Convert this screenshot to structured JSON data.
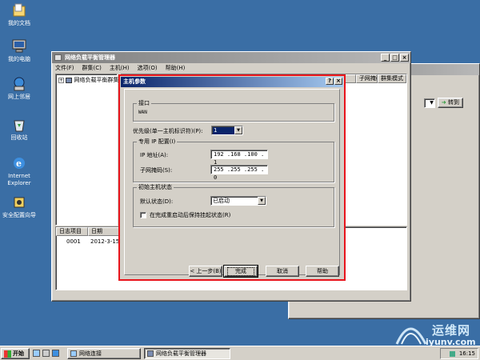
{
  "desktop": {
    "icons": [
      {
        "label": "我的文档",
        "icon": "my-documents-icon"
      },
      {
        "label": "我的电脑",
        "icon": "my-computer-icon"
      },
      {
        "label": "网上邻居",
        "icon": "network-places-icon"
      },
      {
        "label": "回收站",
        "icon": "recycle-bin-icon"
      },
      {
        "label_line1": "Internet",
        "label_line2": "Explorer",
        "icon": "internet-explorer-icon"
      },
      {
        "label": "安全配置向导",
        "icon": "security-wizard-icon"
      }
    ]
  },
  "nlb_window": {
    "title": "网络负载平衡管理器",
    "menu": [
      "文件(F)",
      "群集(C)",
      "主机(H)",
      "选项(O)",
      "帮助(H)"
    ],
    "tree_root": "网络负载平衡群集",
    "columns": [
      "子网掩码",
      "群集模式"
    ],
    "log_headers": [
      "日志项目",
      "日期"
    ],
    "log_rows": [
      {
        "id": "0001",
        "date": "2012-3-15"
      }
    ]
  },
  "background_window": {
    "go_label": "转到"
  },
  "dialog": {
    "title": "主机参数",
    "help_btn": "?",
    "close_btn": "×",
    "interface_group": "接口",
    "interface_value": "WAN",
    "priority_label": "优先级(单一主机标识符)(P):",
    "priority_value": "1",
    "dedicated_ip_group": "专用 IP 配置(I)",
    "ip_label": "IP 地址(A):",
    "ip_value": "192 .168 .100 . 1",
    "mask_label": "子网掩码(S):",
    "mask_value": "255 .255 .255 . 0",
    "initial_state_group": "初始主机状态",
    "default_state_label": "默认状态(D):",
    "default_state_value": "已启动",
    "retain_label": "在完成重启动后保持挂起状态(R)",
    "retain_checked": false,
    "back_button": "< 上一步(B)",
    "finish_button": "完成",
    "cancel_button": "取消",
    "help_button": "帮助"
  },
  "taskbar": {
    "start": "开始",
    "items": [
      {
        "label": "网络连接",
        "active": false
      },
      {
        "label": "网络负载平衡管理器",
        "active": true
      }
    ],
    "clock": "16:15"
  },
  "watermark": {
    "line1": "运维网",
    "line2": "iyunv.com"
  },
  "colors": {
    "desktop": "#3a6ea5",
    "active_title": "#0a246a",
    "highlight_border": "#e8141c"
  }
}
